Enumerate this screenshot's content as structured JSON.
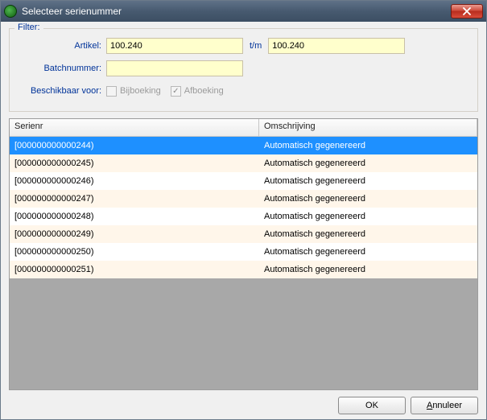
{
  "window": {
    "title": "Selecteer serienummer"
  },
  "filter": {
    "title": "Filter:",
    "artikel_label": "Artikel:",
    "artikel_from": "100.240",
    "tm_label": "t/m",
    "artikel_to": "100.240",
    "batch_label": "Batchnummer:",
    "batch_value": "",
    "beschikbaar_label": "Beschikbaar voor:",
    "bijboeking_label": "Bijboeking",
    "bijboeking_checked": false,
    "afboeking_label": "Afboeking",
    "afboeking_checked": true
  },
  "grid": {
    "head_serial": "Serienr",
    "head_desc": "Omschrijving",
    "rows": [
      {
        "serial": "[000000000000244)",
        "desc": "Automatisch gegenereerd",
        "selected": true
      },
      {
        "serial": "[000000000000245)",
        "desc": "Automatisch gegenereerd",
        "selected": false
      },
      {
        "serial": "[000000000000246)",
        "desc": "Automatisch gegenereerd",
        "selected": false
      },
      {
        "serial": "[000000000000247)",
        "desc": "Automatisch gegenereerd",
        "selected": false
      },
      {
        "serial": "[000000000000248)",
        "desc": "Automatisch gegenereerd",
        "selected": false
      },
      {
        "serial": "[000000000000249)",
        "desc": "Automatisch gegenereerd",
        "selected": false
      },
      {
        "serial": "[000000000000250)",
        "desc": "Automatisch gegenereerd",
        "selected": false
      },
      {
        "serial": "[000000000000251)",
        "desc": "Automatisch gegenereerd",
        "selected": false
      }
    ]
  },
  "buttons": {
    "ok": "OK",
    "cancel": "Annuleer"
  }
}
